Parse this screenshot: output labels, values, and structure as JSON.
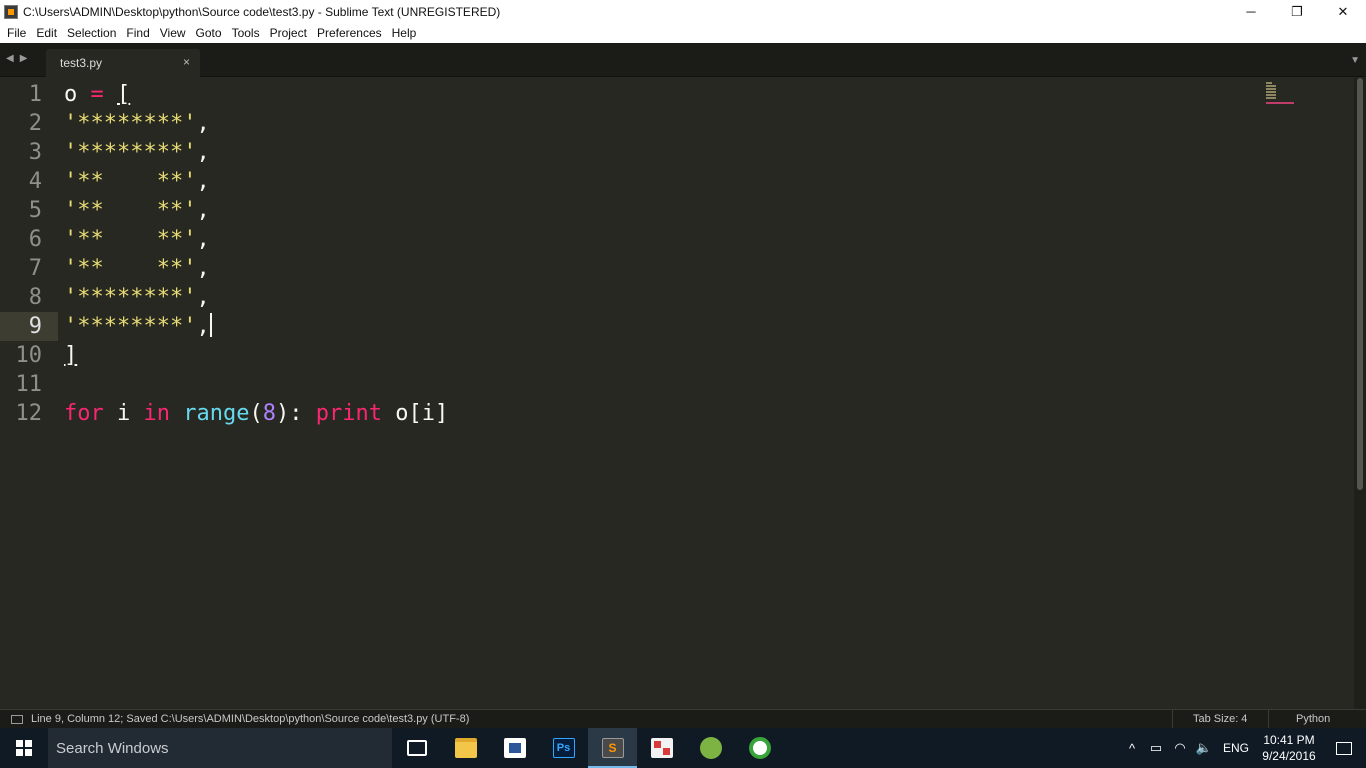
{
  "window": {
    "title": "C:\\Users\\ADMIN\\Desktop\\python\\Source code\\test3.py - Sublime Text (UNREGISTERED)",
    "minimize": "─",
    "restore": "❐",
    "close": "✕"
  },
  "menu": [
    "File",
    "Edit",
    "Selection",
    "Find",
    "View",
    "Goto",
    "Tools",
    "Project",
    "Preferences",
    "Help"
  ],
  "tabs": {
    "nav_back": "◀",
    "nav_forward": "▶",
    "active_tab": "test3.py",
    "close_glyph": "×",
    "dropdown_glyph": "▼"
  },
  "editor": {
    "line_numbers": [
      "1",
      "2",
      "3",
      "4",
      "5",
      "6",
      "7",
      "8",
      "9",
      "10",
      "11",
      "12"
    ],
    "active_line": 9,
    "lines": [
      {
        "parts": [
          {
            "t": "o ",
            "c": ""
          },
          {
            "t": "=",
            "c": "kw"
          },
          {
            "t": " ",
            "c": ""
          },
          {
            "t": "[",
            "c": "bracket-ul"
          }
        ]
      },
      {
        "parts": [
          {
            "t": "'********'",
            "c": "str"
          },
          {
            "t": ",",
            "c": ""
          }
        ]
      },
      {
        "parts": [
          {
            "t": "'********'",
            "c": "str"
          },
          {
            "t": ",",
            "c": ""
          }
        ]
      },
      {
        "parts": [
          {
            "t": "'**    **'",
            "c": "str"
          },
          {
            "t": ",",
            "c": ""
          }
        ]
      },
      {
        "parts": [
          {
            "t": "'**    **'",
            "c": "str"
          },
          {
            "t": ",",
            "c": ""
          }
        ]
      },
      {
        "parts": [
          {
            "t": "'**    **'",
            "c": "str"
          },
          {
            "t": ",",
            "c": ""
          }
        ]
      },
      {
        "parts": [
          {
            "t": "'**    **'",
            "c": "str"
          },
          {
            "t": ",",
            "c": ""
          }
        ]
      },
      {
        "parts": [
          {
            "t": "'********'",
            "c": "str"
          },
          {
            "t": ",",
            "c": ""
          }
        ]
      },
      {
        "parts": [
          {
            "t": "'********'",
            "c": "str"
          },
          {
            "t": ",",
            "c": ""
          }
        ],
        "caret": true
      },
      {
        "parts": [
          {
            "t": "]",
            "c": "bracket-ul"
          }
        ]
      },
      {
        "parts": []
      },
      {
        "parts": [
          {
            "t": "for",
            "c": "kw"
          },
          {
            "t": " i ",
            "c": ""
          },
          {
            "t": "in",
            "c": "kw"
          },
          {
            "t": " ",
            "c": ""
          },
          {
            "t": "range",
            "c": "fn"
          },
          {
            "t": "(",
            "c": ""
          },
          {
            "t": "8",
            "c": "num"
          },
          {
            "t": "): ",
            "c": ""
          },
          {
            "t": "print",
            "c": "kw"
          },
          {
            "t": " o[i]",
            "c": ""
          }
        ]
      }
    ]
  },
  "status": {
    "message": "Line 9, Column 12; Saved C:\\Users\\ADMIN\\Desktop\\python\\Source code\\test3.py (UTF-8)",
    "tab_size": "Tab Size: 4",
    "syntax": "Python"
  },
  "taskbar": {
    "search_placeholder": "Search Windows",
    "apps": [
      {
        "name": "task-view",
        "icon": "task-view-icon"
      },
      {
        "name": "file-explorer",
        "icon": "folder-icon"
      },
      {
        "name": "store",
        "icon": "store-icon"
      },
      {
        "name": "photoshop",
        "icon": "photoshop-icon",
        "label": "Ps"
      },
      {
        "name": "sublime-text",
        "icon": "sublime-icon",
        "label": "S",
        "active": true
      },
      {
        "name": "tool",
        "icon": "tool-icon"
      },
      {
        "name": "android-studio",
        "icon": "android-icon"
      },
      {
        "name": "green-app",
        "icon": "green-circle-icon"
      }
    ],
    "tray": {
      "chevron": "^",
      "battery": "▭",
      "wifi": "◠",
      "volume": "🔈",
      "language": "ENG",
      "time": "10:41 PM",
      "date": "9/24/2016"
    }
  },
  "colors": {
    "editor_bg": "#272822",
    "keyword": "#f92672",
    "string": "#e6db74",
    "function": "#66d9ef",
    "number": "#ae81ff",
    "taskbar_accent": "#76b9ed"
  }
}
